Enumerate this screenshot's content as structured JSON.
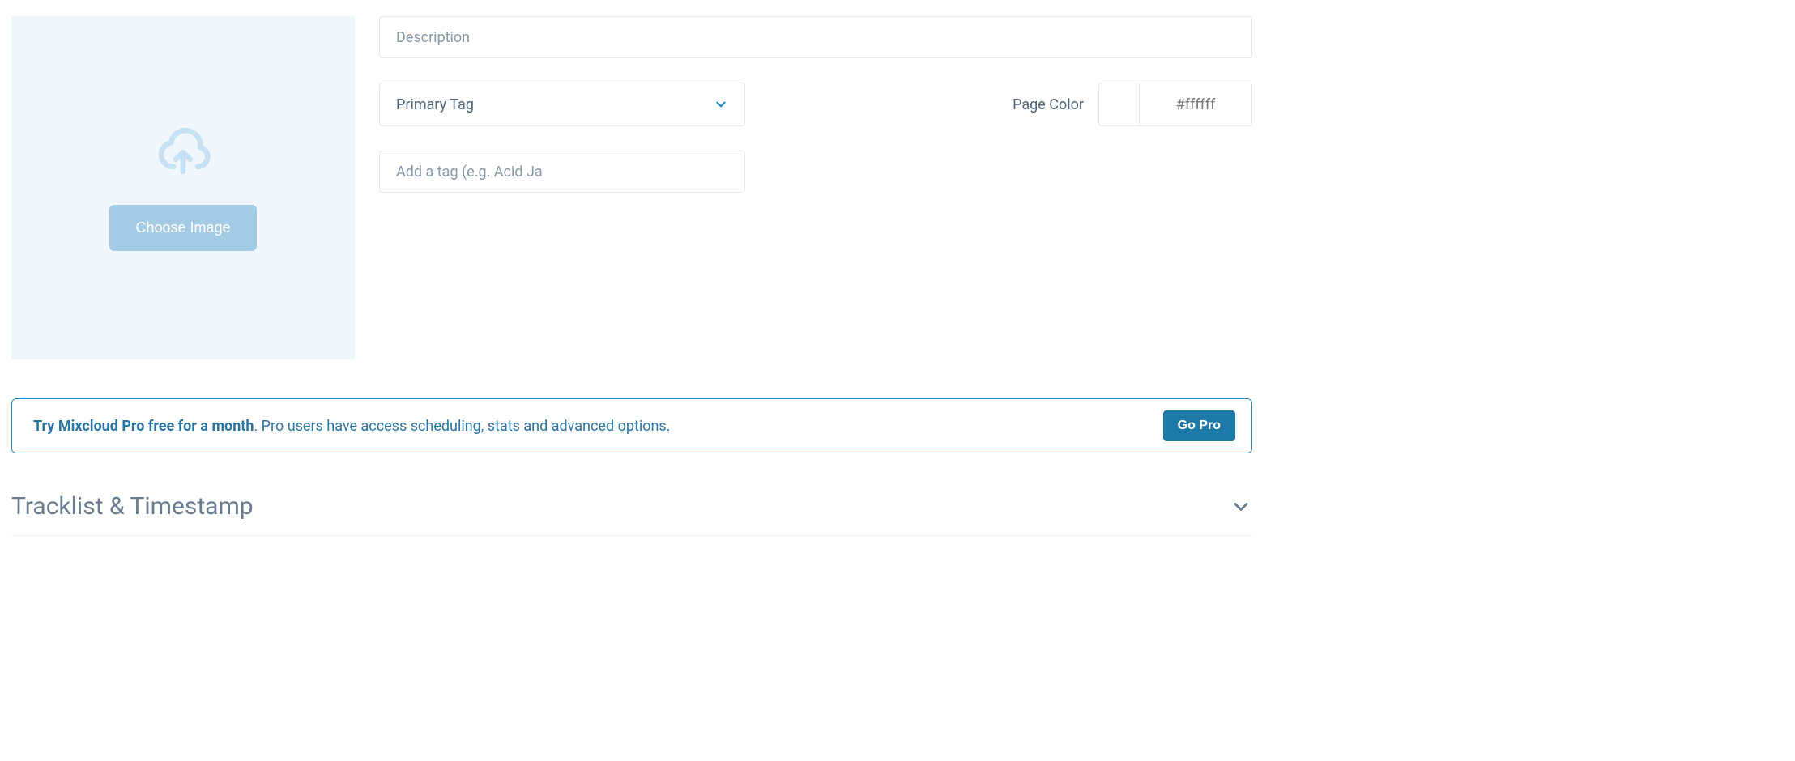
{
  "upload": {
    "button_label": "Choose Image"
  },
  "description": {
    "placeholder": "Description",
    "value": ""
  },
  "primary_tag": {
    "label": "Primary Tag"
  },
  "page_color": {
    "label": "Page Color",
    "hex": "#ffffff"
  },
  "tag_input": {
    "placeholder": "Add a tag (e.g. Acid Ja",
    "value": ""
  },
  "promo": {
    "bold": "Try Mixcloud Pro free for a month",
    "rest": ". Pro users have access scheduling, stats and advanced options.",
    "button": "Go Pro"
  },
  "section": {
    "title": "Tracklist & Timestamp"
  }
}
